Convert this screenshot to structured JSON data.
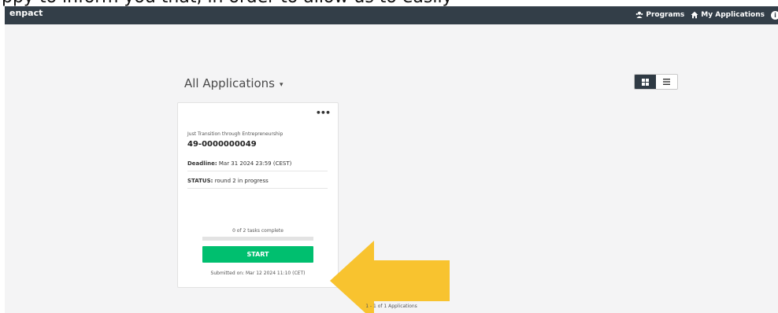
{
  "caption": "ppy to inform you that, in order to allow us to easily",
  "topbar": {
    "brand": "enpact",
    "nav": [
      {
        "label": "Programs",
        "icon": "users-icon"
      },
      {
        "label": "My Applications",
        "icon": "home-icon"
      }
    ],
    "info_icon": "i"
  },
  "main": {
    "heading": "All Applications",
    "heading_caret": "▾",
    "view_toggle": {
      "grid_icon": "grid-icon",
      "list_icon": "list-icon",
      "active": "grid"
    }
  },
  "card": {
    "menu": "•••",
    "program": "Just Transition through Entrepreneurship",
    "app_id": "49-0000000049",
    "deadline_label": "Deadline:",
    "deadline_value": "Mar 31 2024 23:59 (CEST)",
    "status_label": "STATUS:",
    "status_value": "round 2 in progress",
    "tasks_text": "0 of 2 tasks complete",
    "progress": 0,
    "start_label": "START",
    "submitted_text": "Submitted on: Mar 12 2024 11:10 (CET)"
  },
  "annotation": {
    "color": "#f8c32f",
    "direction": "left"
  },
  "pager": "1 - 1 of 1 Applications"
}
